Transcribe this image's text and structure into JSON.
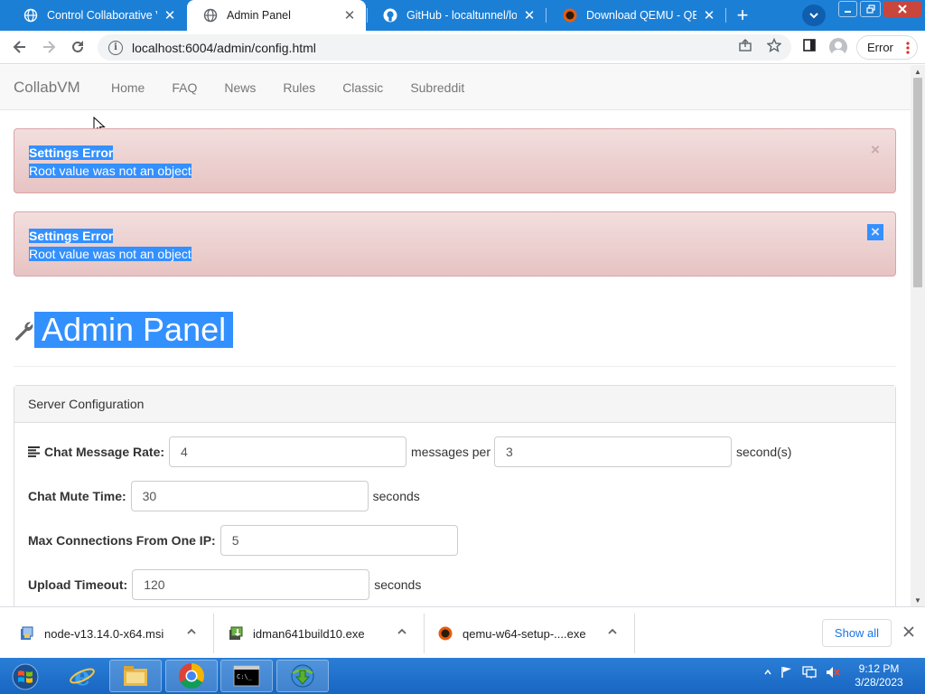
{
  "browser": {
    "tabs": [
      {
        "title": "Control Collaborative Virtual Machines",
        "active": false,
        "icon": "globe-icon"
      },
      {
        "title": "Admin Panel",
        "active": true,
        "icon": "globe-icon"
      },
      {
        "title": "GitHub - localtunnel/localtunnel",
        "active": false,
        "icon": "github-icon"
      },
      {
        "title": "Download QEMU - QEMU",
        "active": false,
        "icon": "qemu-icon"
      }
    ],
    "new_tab_label": "+",
    "url": "localhost:6004/admin/config.html",
    "profile_error_label": "Error"
  },
  "site": {
    "brand": "CollabVM",
    "nav": [
      "Home",
      "FAQ",
      "News",
      "Rules",
      "Classic",
      "Subreddit"
    ]
  },
  "alerts": [
    {
      "title": "Settings Error",
      "message": "Root value was not an object"
    },
    {
      "title": "Settings Error",
      "message": "Root value was not an object"
    }
  ],
  "page": {
    "title": "Admin Panel",
    "panel_heading": "Server Configuration",
    "fields": {
      "chat_rate": {
        "label": "Chat Message Rate:",
        "value1": "4",
        "middle": "messages per",
        "value2": "3",
        "after": "second(s)"
      },
      "mute_time": {
        "label": "Chat Mute Time:",
        "value": "30",
        "after": "seconds"
      },
      "max_conn": {
        "label": "Max Connections From One IP:",
        "value": "5"
      },
      "upload_timeout": {
        "label": "Upload Timeout:",
        "value": "120",
        "after": "seconds"
      }
    }
  },
  "downloads": {
    "items": [
      {
        "name": "node-v13.14.0-x64.msi",
        "icon": "msi-installer-icon"
      },
      {
        "name": "idman641build10.exe",
        "icon": "idm-installer-icon"
      },
      {
        "name": "qemu-w64-setup-....exe",
        "icon": "qemu-icon"
      }
    ],
    "show_all": "Show all"
  },
  "taskbar": {
    "apps": [
      "internet-explorer-icon",
      "file-explorer-icon",
      "chrome-icon",
      "cmd-icon",
      "idm-icon"
    ],
    "time": "9:12 PM",
    "date": "3/28/2023"
  },
  "colors": {
    "chrome_frame": "#1c7fd6",
    "alert_bg": "#f2dede",
    "selection": "#3390ff",
    "taskbar": "#1f72cc"
  }
}
